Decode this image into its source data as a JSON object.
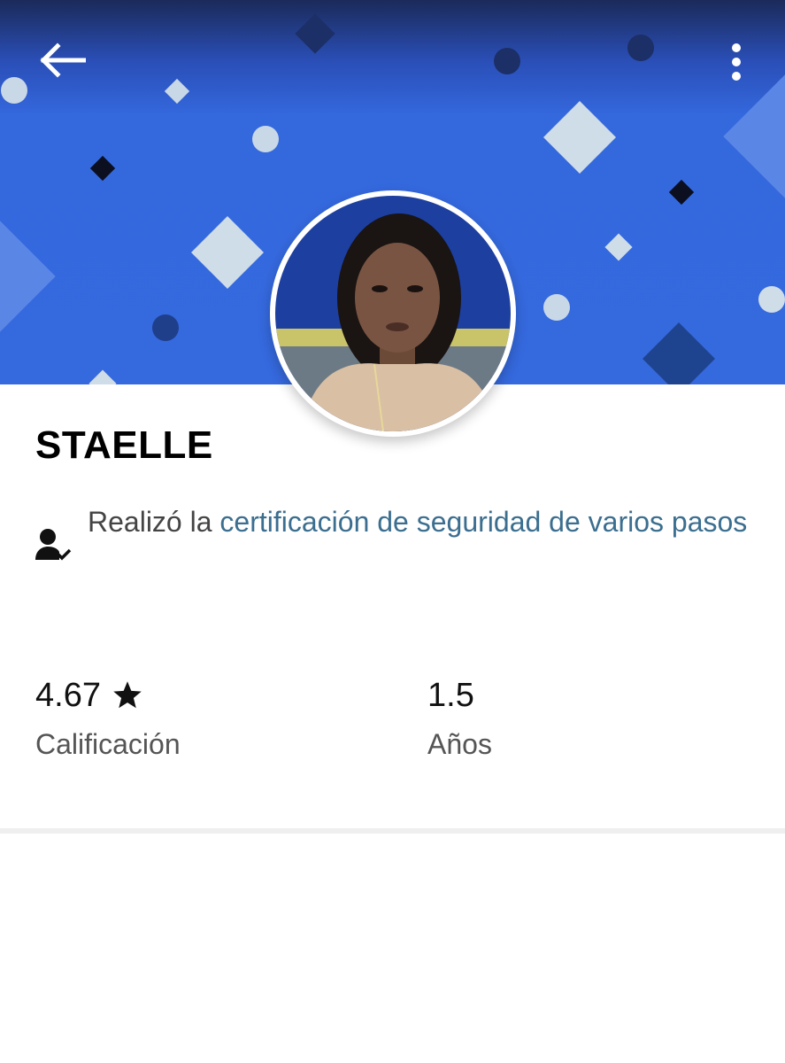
{
  "header": {
    "back_icon": "arrow-left-icon",
    "menu_icon": "more-vertical-icon",
    "accent_color": "#3569de"
  },
  "profile": {
    "name": "STAELLE",
    "avatar": "profile-photo"
  },
  "certification": {
    "icon": "person-check-icon",
    "prefix": "Realizó la ",
    "link_text": "certificación de seguridad de varios pasos",
    "link_color": "#3b6e8f"
  },
  "stats": [
    {
      "value": "4.67",
      "icon": "star-icon",
      "label": "Calificación"
    },
    {
      "value": "1.5",
      "label": "Años"
    }
  ]
}
